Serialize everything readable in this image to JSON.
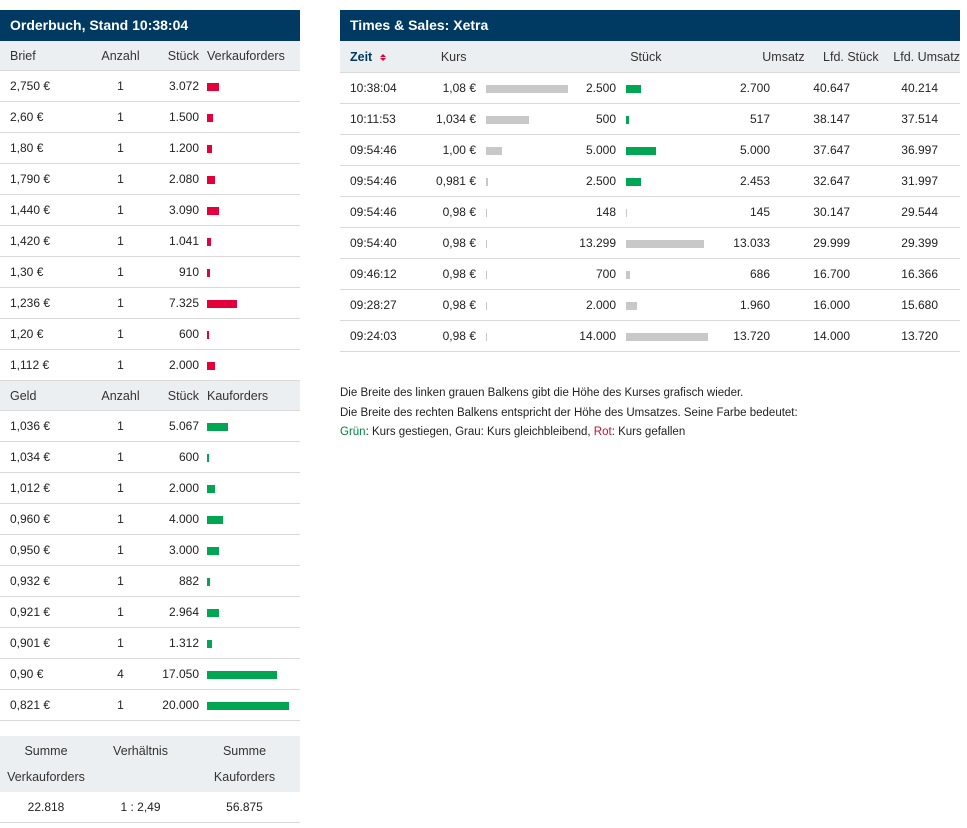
{
  "orderbook": {
    "title": "Orderbuch, Stand 10:38:04",
    "ask_header": {
      "price": "Brief",
      "count": "Anzahl",
      "qty": "Stück",
      "bar": "Verkauforders"
    },
    "asks": [
      {
        "price": "2,750 €",
        "count": "1",
        "qty": "3.072",
        "bar_fraction": 0.15
      },
      {
        "price": "2,60 €",
        "count": "1",
        "qty": "1.500",
        "bar_fraction": 0.07
      },
      {
        "price": "1,80 €",
        "count": "1",
        "qty": "1.200",
        "bar_fraction": 0.06
      },
      {
        "price": "1,790 €",
        "count": "1",
        "qty": "2.080",
        "bar_fraction": 0.1
      },
      {
        "price": "1,440 €",
        "count": "1",
        "qty": "3.090",
        "bar_fraction": 0.15
      },
      {
        "price": "1,420 €",
        "count": "1",
        "qty": "1.041",
        "bar_fraction": 0.05
      },
      {
        "price": "1,30 €",
        "count": "1",
        "qty": "910",
        "bar_fraction": 0.04
      },
      {
        "price": "1,236 €",
        "count": "1",
        "qty": "7.325",
        "bar_fraction": 0.37
      },
      {
        "price": "1,20 €",
        "count": "1",
        "qty": "600",
        "bar_fraction": 0.03
      },
      {
        "price": "1,112 €",
        "count": "1",
        "qty": "2.000",
        "bar_fraction": 0.1
      }
    ],
    "bid_header": {
      "price": "Geld",
      "count": "Anzahl",
      "qty": "Stück",
      "bar": "Kauforders"
    },
    "bids": [
      {
        "price": "1,036 €",
        "count": "1",
        "qty": "5.067",
        "bar_fraction": 0.25
      },
      {
        "price": "1,034 €",
        "count": "1",
        "qty": "600",
        "bar_fraction": 0.03
      },
      {
        "price": "1,012 €",
        "count": "1",
        "qty": "2.000",
        "bar_fraction": 0.1
      },
      {
        "price": "0,960 €",
        "count": "1",
        "qty": "4.000",
        "bar_fraction": 0.2
      },
      {
        "price": "0,950 €",
        "count": "1",
        "qty": "3.000",
        "bar_fraction": 0.15
      },
      {
        "price": "0,932 €",
        "count": "1",
        "qty": "882",
        "bar_fraction": 0.04
      },
      {
        "price": "0,921 €",
        "count": "1",
        "qty": "2.964",
        "bar_fraction": 0.15
      },
      {
        "price": "0,901 €",
        "count": "1",
        "qty": "1.312",
        "bar_fraction": 0.06
      },
      {
        "price": "0,90 €",
        "count": "4",
        "qty": "17.050",
        "bar_fraction": 0.85
      },
      {
        "price": "0,821 €",
        "count": "1",
        "qty": "20.000",
        "bar_fraction": 1.0
      }
    ],
    "summary": {
      "col1_line1": "Summe",
      "col1_line2": "Verkauforders",
      "col2_line1": "Verhältnis",
      "col3_line1": "Summe",
      "col3_line2": "Kauforders",
      "sum_sell": "22.818",
      "ratio": "1 : 2,49",
      "sum_buy": "56.875"
    }
  },
  "times_sales": {
    "title": "Times & Sales: Xetra",
    "header": {
      "time": "Zeit",
      "price": "Kurs",
      "qty": "Stück",
      "turnover": "Umsatz",
      "cum_qty": "Lfd. Stück",
      "cum_turnover": "Lfd. Umsatz"
    },
    "rows": [
      {
        "time": "10:38:04",
        "price": "1,08 €",
        "price_fraction": 1.0,
        "qty": "2.500",
        "turnover_fraction": 0.18,
        "trend": "green",
        "turnover": "2.700",
        "cum_qty": "40.647",
        "cum_turnover": "40.214"
      },
      {
        "time": "10:11:53",
        "price": "1,034 €",
        "price_fraction": 0.53,
        "qty": "500",
        "turnover_fraction": 0.04,
        "trend": "green",
        "turnover": "517",
        "cum_qty": "38.147",
        "cum_turnover": "37.514"
      },
      {
        "time": "09:54:46",
        "price": "1,00 €",
        "price_fraction": 0.2,
        "qty": "5.000",
        "turnover_fraction": 0.36,
        "trend": "green",
        "turnover": "5.000",
        "cum_qty": "37.647",
        "cum_turnover": "36.997"
      },
      {
        "time": "09:54:46",
        "price": "0,981 €",
        "price_fraction": 0.02,
        "qty": "2.500",
        "turnover_fraction": 0.18,
        "trend": "green",
        "turnover": "2.453",
        "cum_qty": "32.647",
        "cum_turnover": "31.997"
      },
      {
        "time": "09:54:46",
        "price": "0,98 €",
        "price_fraction": 0.01,
        "qty": "148",
        "turnover_fraction": 0.01,
        "trend": "grey",
        "turnover": "145",
        "cum_qty": "30.147",
        "cum_turnover": "29.544"
      },
      {
        "time": "09:54:40",
        "price": "0,98 €",
        "price_fraction": 0.01,
        "qty": "13.299",
        "turnover_fraction": 0.95,
        "trend": "grey",
        "turnover": "13.033",
        "cum_qty": "29.999",
        "cum_turnover": "29.399"
      },
      {
        "time": "09:46:12",
        "price": "0,98 €",
        "price_fraction": 0.01,
        "qty": "700",
        "turnover_fraction": 0.05,
        "trend": "grey",
        "turnover": "686",
        "cum_qty": "16.700",
        "cum_turnover": "16.366"
      },
      {
        "time": "09:28:27",
        "price": "0,98 €",
        "price_fraction": 0.01,
        "qty": "2.000",
        "turnover_fraction": 0.14,
        "trend": "grey",
        "turnover": "1.960",
        "cum_qty": "16.000",
        "cum_turnover": "15.680"
      },
      {
        "time": "09:24:03",
        "price": "0,98 €",
        "price_fraction": 0.01,
        "qty": "14.000",
        "turnover_fraction": 1.0,
        "trend": "grey",
        "turnover": "13.720",
        "cum_qty": "14.000",
        "cum_turnover": "13.720"
      }
    ],
    "legend": {
      "line1": "Die Breite des linken grauen Balkens gibt die Höhe des Kurses grafisch wieder.",
      "line2": "Die Breite des rechten Balkens entspricht der Höhe des Umsatzes. Seine Farbe bedeutet:",
      "green_word": "Grün",
      "green_text": ": Kurs gestiegen, Grau: Kurs gleichbleibend, ",
      "red_word": "Rot",
      "red_text": ": Kurs gefallen"
    }
  },
  "colors": {
    "header_bg": "#003a63",
    "sell": "#e4003a",
    "buy": "#00a651",
    "neutral": "#c8c8c8"
  }
}
